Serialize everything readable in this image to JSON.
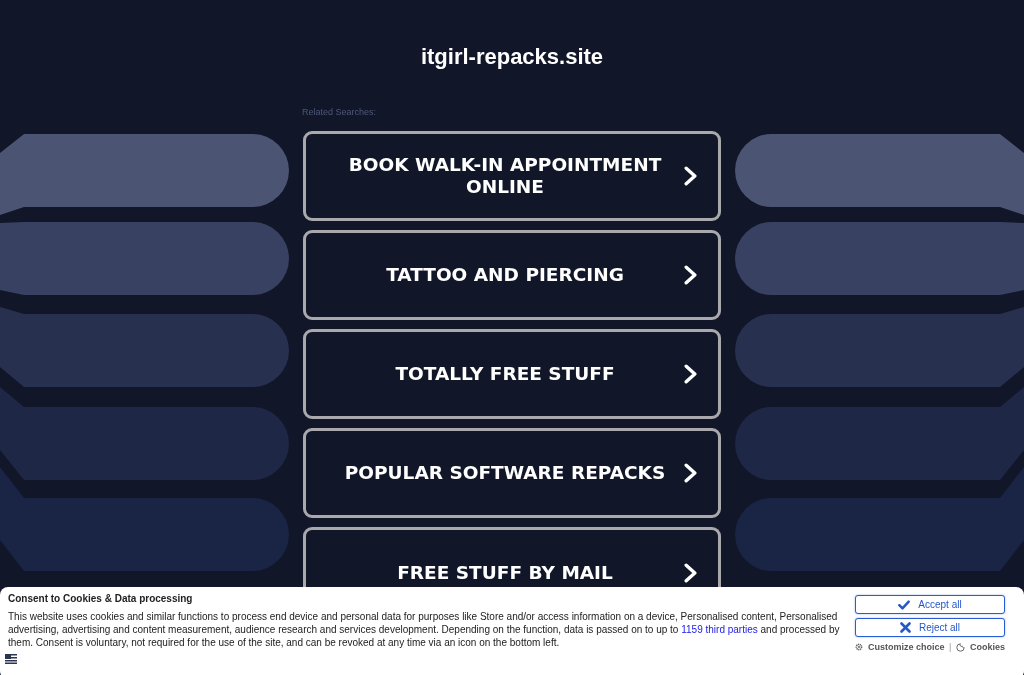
{
  "site_title": "itgirl-repacks.site",
  "related_label": "Related Searches:",
  "searches": [
    {
      "label": "BOOK WALK-IN APPOINTMENT ONLINE"
    },
    {
      "label": "TATTOO AND PIERCING"
    },
    {
      "label": "TOTALLY FREE STUFF"
    },
    {
      "label": "POPULAR SOFTWARE REPACKS"
    },
    {
      "label": "FREE STUFF BY MAIL"
    }
  ],
  "consent": {
    "title": "Consent to Cookies & Data processing",
    "text_before": "This website uses cookies and similar functions to process end device and personal data for purposes like Store and/or access information on a device, Personalised content, Personalised advertising, advertising and content measurement, audience research and services development. Depending on the function, data is passed on to up to",
    "link": "1159 third parties",
    "text_after": "and processed by them. Consent is voluntary, not required for the use of the site, and can be revoked at any time via an icon on the bottom left.",
    "accept_button": "Accept all",
    "reject_button": "Reject all",
    "customize_link": "Customize choice",
    "separator": "|",
    "cookies_link": "Cookies"
  }
}
